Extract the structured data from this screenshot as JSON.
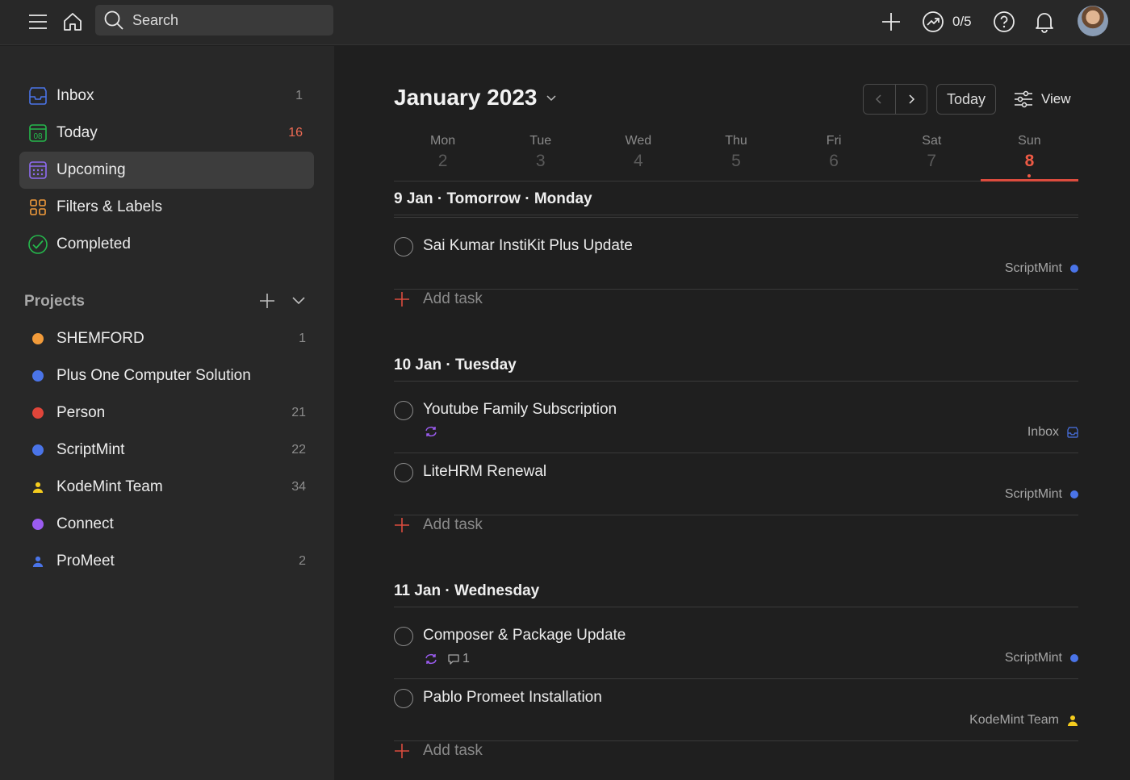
{
  "topbar": {
    "search_placeholder": "Search",
    "karma_value": "0/5",
    "icons": [
      "menu-icon",
      "home-icon",
      "search-icon",
      "plus-icon",
      "trend-icon",
      "help-icon",
      "bell-icon",
      "avatar"
    ]
  },
  "sidebar": {
    "nav": [
      {
        "label": "Inbox",
        "count": "1",
        "icon": "inbox-icon"
      },
      {
        "label": "Today",
        "count": "16",
        "icon": "calendar-today-icon",
        "badge": "08"
      },
      {
        "label": "Upcoming",
        "count": "",
        "icon": "calendar-grid-icon"
      },
      {
        "label": "Filters & Labels",
        "count": "",
        "icon": "grid-icon"
      },
      {
        "label": "Completed",
        "count": "",
        "icon": "check-circle-icon"
      }
    ],
    "projects_title": "Projects",
    "projects": [
      {
        "label": "SHEMFORD",
        "count": "1",
        "color": "#f29b3a"
      },
      {
        "label": "Plus One Computer Solution",
        "count": "",
        "color": "#4a74e8"
      },
      {
        "label": "Person",
        "count": "21",
        "color": "#e0453a"
      },
      {
        "label": "ScriptMint",
        "count": "22",
        "color": "#4a74e8"
      },
      {
        "label": "KodeMint Team",
        "count": "34",
        "color": "#f5cc1e",
        "shared": true
      },
      {
        "label": "Connect",
        "count": "",
        "color": "#9b5cf0"
      },
      {
        "label": "ProMeet",
        "count": "2",
        "color": "#4a74e8",
        "shared": true
      }
    ]
  },
  "main": {
    "month_title": "January 2023",
    "today_label": "Today",
    "view_label": "View",
    "week": [
      {
        "name": "Mon",
        "num": "2"
      },
      {
        "name": "Tue",
        "num": "3"
      },
      {
        "name": "Wed",
        "num": "4"
      },
      {
        "name": "Thu",
        "num": "5"
      },
      {
        "name": "Fri",
        "num": "6"
      },
      {
        "name": "Sat",
        "num": "7"
      },
      {
        "name": "Sun",
        "num": "8",
        "selected": true
      }
    ],
    "sections": [
      {
        "title": "9 Jan · Tomorrow · Monday",
        "tasks": [
          {
            "name": "Sai Kumar InstiKit Plus Update",
            "project": "ScriptMint",
            "project_color": "#4a74e8"
          }
        ],
        "add_label": "Add task"
      },
      {
        "title": "10 Jan · Tuesday",
        "tasks": [
          {
            "name": "Youtube Family Subscription",
            "project": "Inbox",
            "recurring": true
          },
          {
            "name": "LiteHRM Renewal",
            "project": "ScriptMint",
            "project_color": "#4a74e8"
          }
        ],
        "add_label": "Add task"
      },
      {
        "title": "11 Jan · Wednesday",
        "tasks": [
          {
            "name": "Composer & Package Update",
            "project": "ScriptMint",
            "project_color": "#4a74e8",
            "recurring": true,
            "comments": "1"
          },
          {
            "name": "Pablo Promeet Installation",
            "project": "KodeMint Team",
            "project_color": "#f5cc1e"
          }
        ],
        "add_label": "Add task"
      }
    ]
  }
}
